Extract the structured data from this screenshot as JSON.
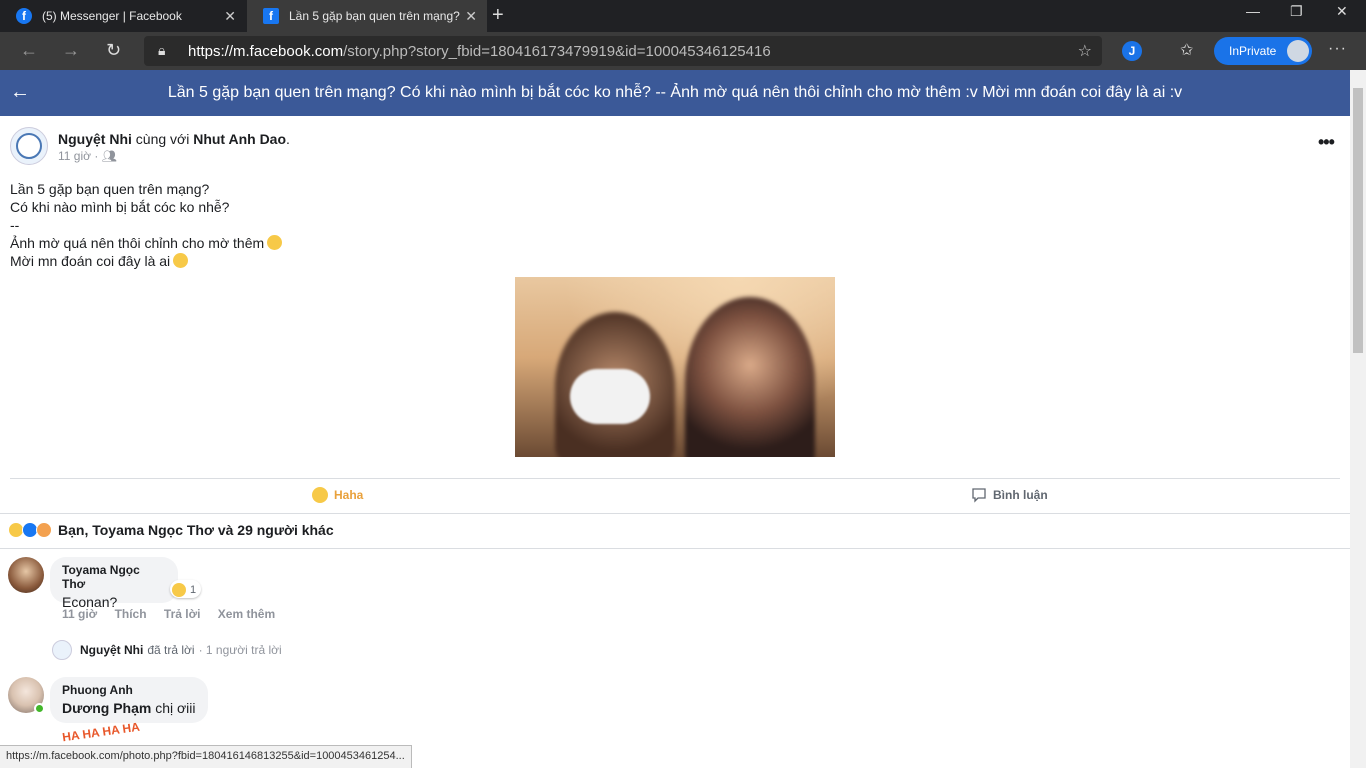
{
  "browser": {
    "tabs": [
      {
        "label": "(5) Messenger | Facebook",
        "active": false
      },
      {
        "label": "Lần 5 gặp bạn quen trên mạng?",
        "active": true
      }
    ],
    "url_host": "https://m.facebook.com",
    "url_path": "/story.php?story_fbid=180416173479919&id=100045346125416",
    "extension_letter": "J",
    "profile_label": "InPrivate",
    "status_url": "https://m.facebook.com/photo.php?fbid=180416146813255&id=1000453461254..."
  },
  "header": {
    "title": "Lần 5 gặp bạn quen trên mạng? Có khi nào mình bị bắt cóc ko nhễ? -- Ảnh mờ quá nên thôi chỉnh cho mờ thêm :v Mời mn đoán coi đây là ai :v"
  },
  "post": {
    "author": "Nguyệt Nhi",
    "with_text": "cùng với",
    "tagged": "Nhut Anh Dao",
    "time": "11 giờ ·",
    "lines": [
      "Lần 5 gặp bạn quen trên mạng?",
      "Có khi nào mình bị bắt cóc ko nhễ?",
      "--",
      "Ảnh mờ quá nên thôi chỉnh cho mờ thêm",
      "Mời mn đoán coi đây là ai"
    ],
    "actions": {
      "haha": "Haha",
      "comment": "Bình luận"
    },
    "reactions_summary": "Bạn, Toyama Ngọc Thơ và 29 người khác"
  },
  "comments": [
    {
      "name": "Toyama Ngọc Thơ",
      "text": "Econan?",
      "reaction_count": "1",
      "time": "11 giờ",
      "like": "Thích",
      "reply": "Trả lời",
      "more": "Xem thêm",
      "reply_author": "Nguyệt Nhi",
      "reply_action": "đã trả lời",
      "reply_count": "· 1 người trả lời"
    },
    {
      "name": "Phuong Anh",
      "mention": "Dương Phạm",
      "text": "chị ơiii",
      "sticker_text": "HA HA HA HA"
    }
  ],
  "colors": {
    "brand": "#3b5998",
    "haha": "#e9a13b",
    "browser_dark": "#202124"
  }
}
